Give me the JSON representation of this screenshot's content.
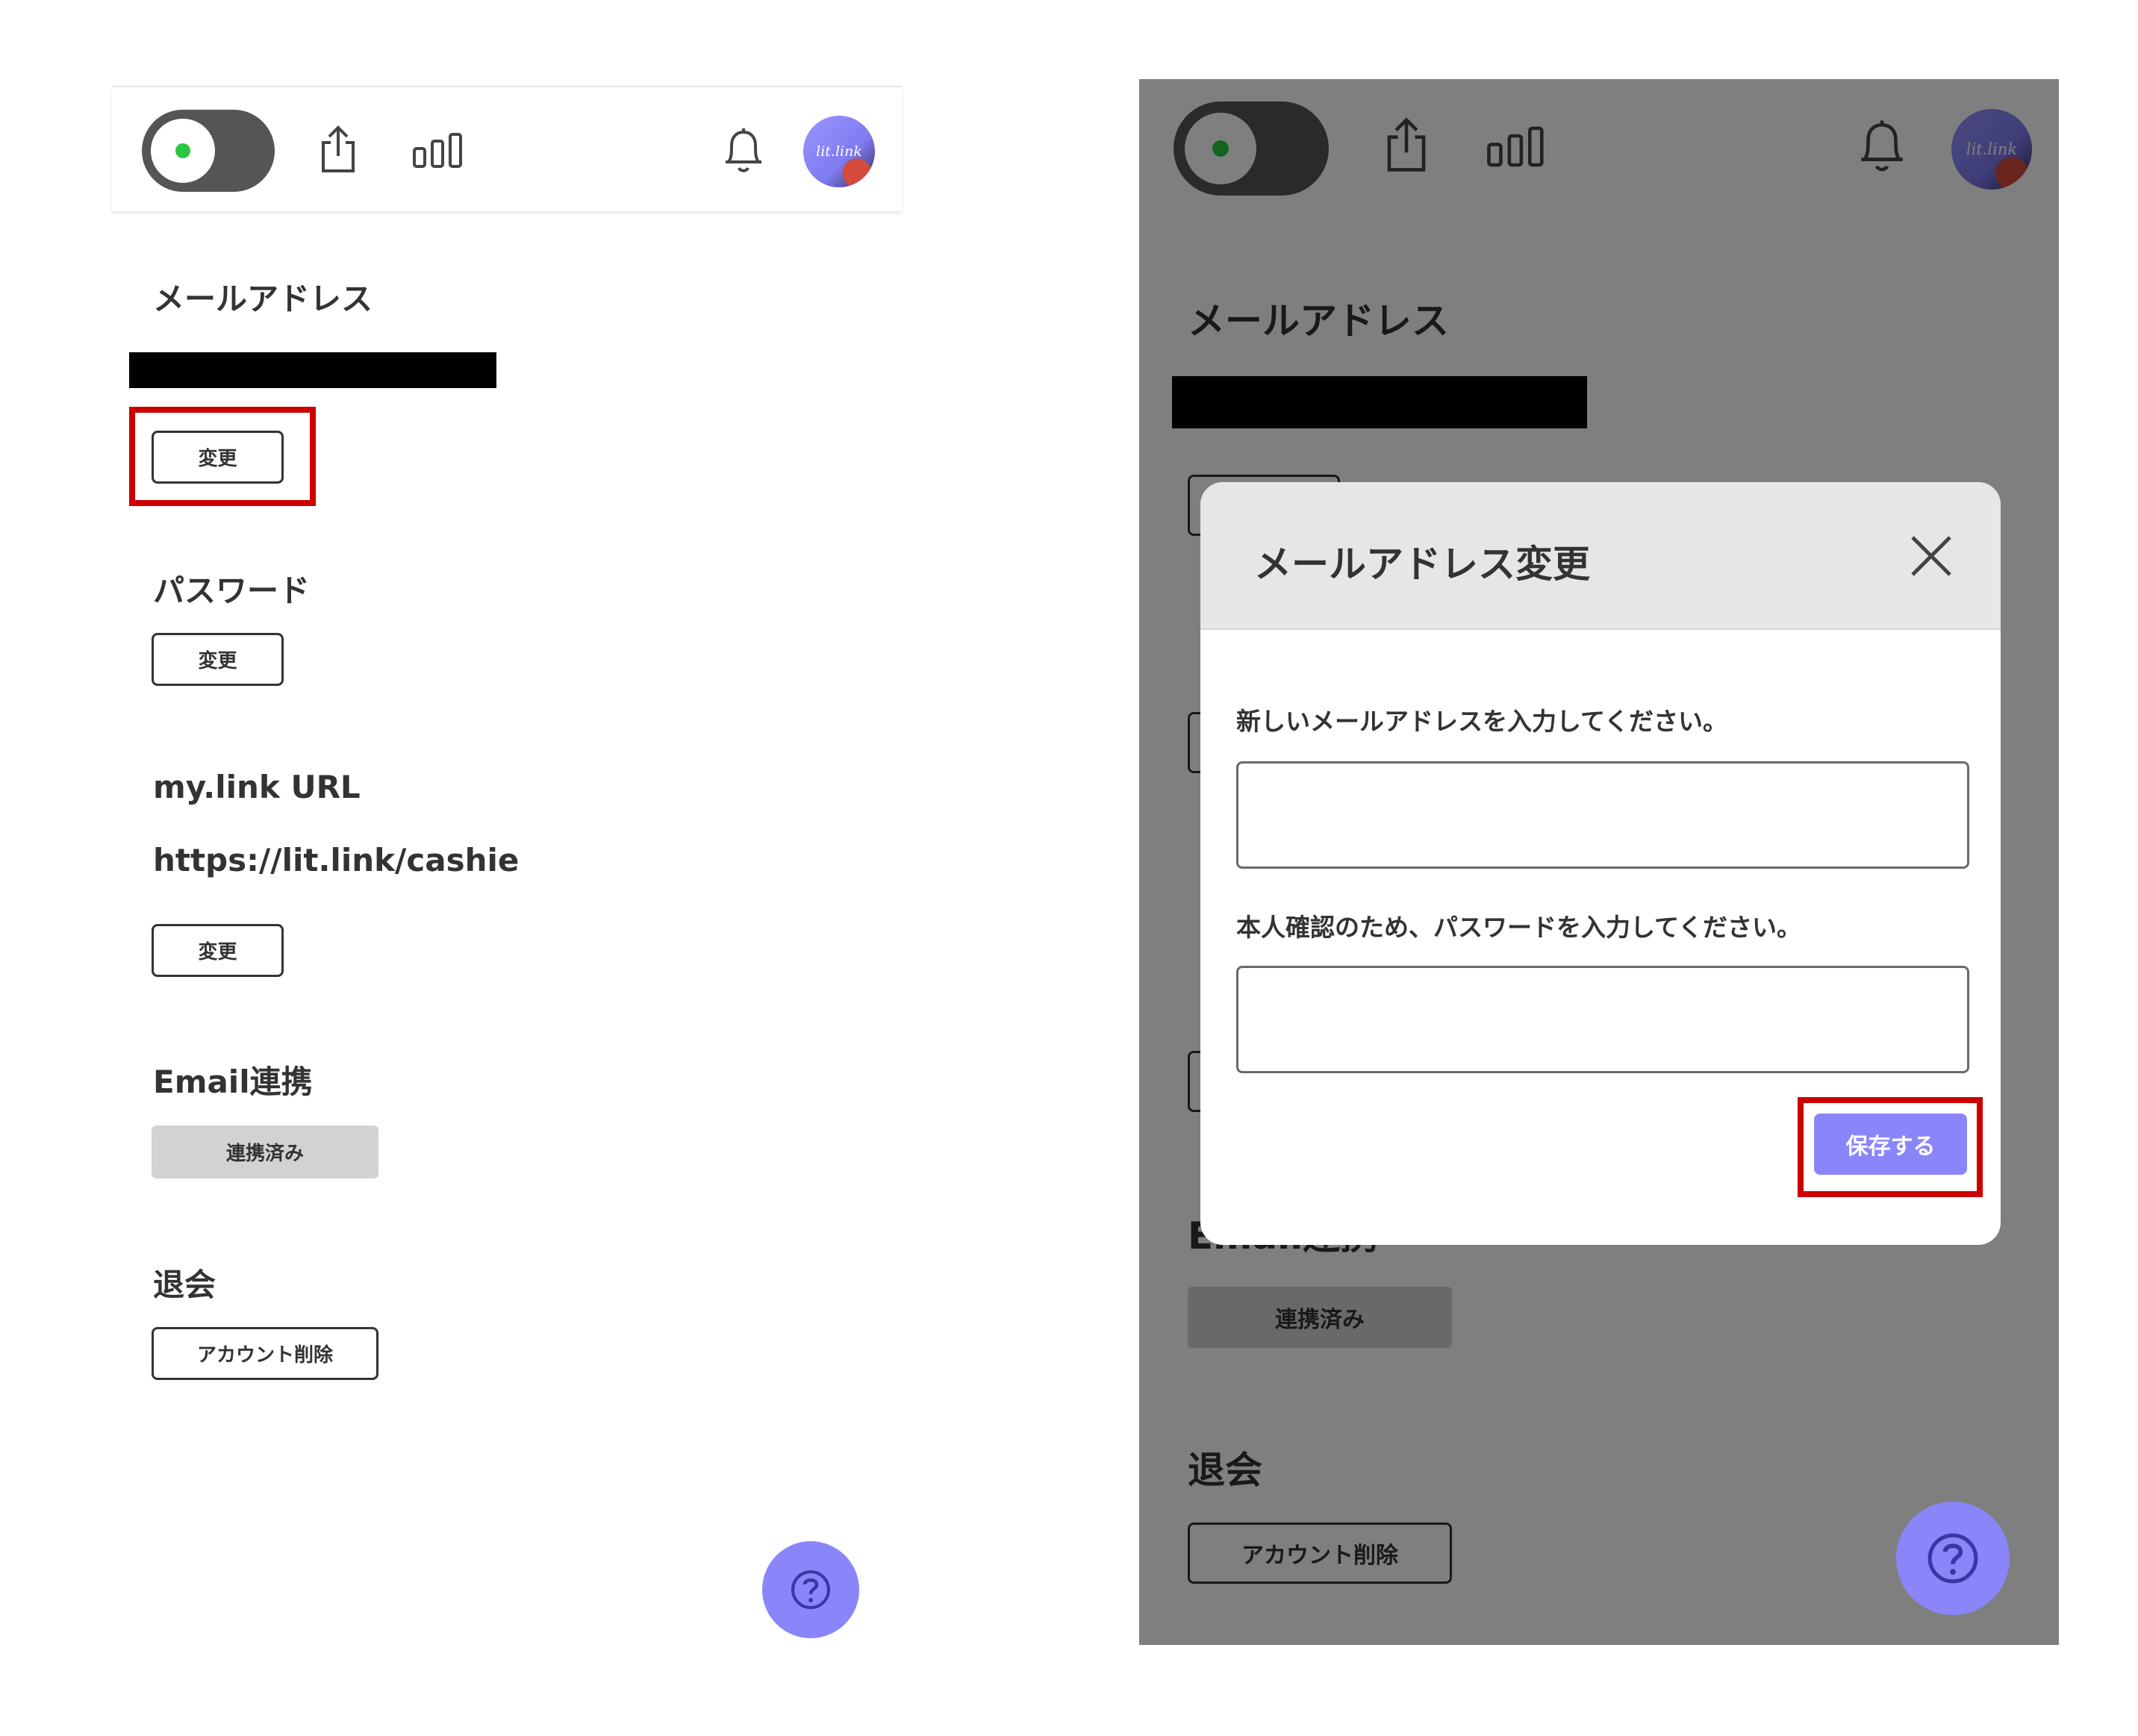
{
  "left": {
    "header": {
      "avatar_text": "lit.link"
    },
    "email": {
      "title": "メールアドレス",
      "change_label": "変更"
    },
    "password": {
      "title": "パスワード",
      "change_label": "変更"
    },
    "mylink": {
      "title": "my.link URL",
      "url": "https://lit.link/cashie",
      "change_label": "変更"
    },
    "email_link": {
      "title": "Email連携",
      "status_label": "連携済み"
    },
    "withdraw": {
      "title": "退会",
      "delete_label": "アカウント削除"
    },
    "help_symbol": "?"
  },
  "right": {
    "header": {
      "avatar_text": "lit.link"
    },
    "background": {
      "email_title": "メールアドレス",
      "email_link_title": "Email連携",
      "email_link_status": "連携済み",
      "withdraw_title": "退会",
      "delete_label": "アカウント削除"
    },
    "modal": {
      "title": "メールアドレス変更",
      "new_email_label": "新しいメールアドレスを入力してください。",
      "new_email_value": "",
      "password_label": "本人確認のため、パスワードを入力してください。",
      "password_value": "",
      "save_label": "保存する"
    },
    "help_symbol": "?"
  },
  "colors": {
    "accent": "#8a86fa",
    "highlight": "#cc0000",
    "online_dot": "#28c840",
    "toggle": "#555555",
    "overlay": "rgba(0,0,0,0.5)"
  },
  "icons": [
    "share-icon",
    "analytics-icon",
    "bell-icon",
    "close-icon",
    "help-icon"
  ]
}
